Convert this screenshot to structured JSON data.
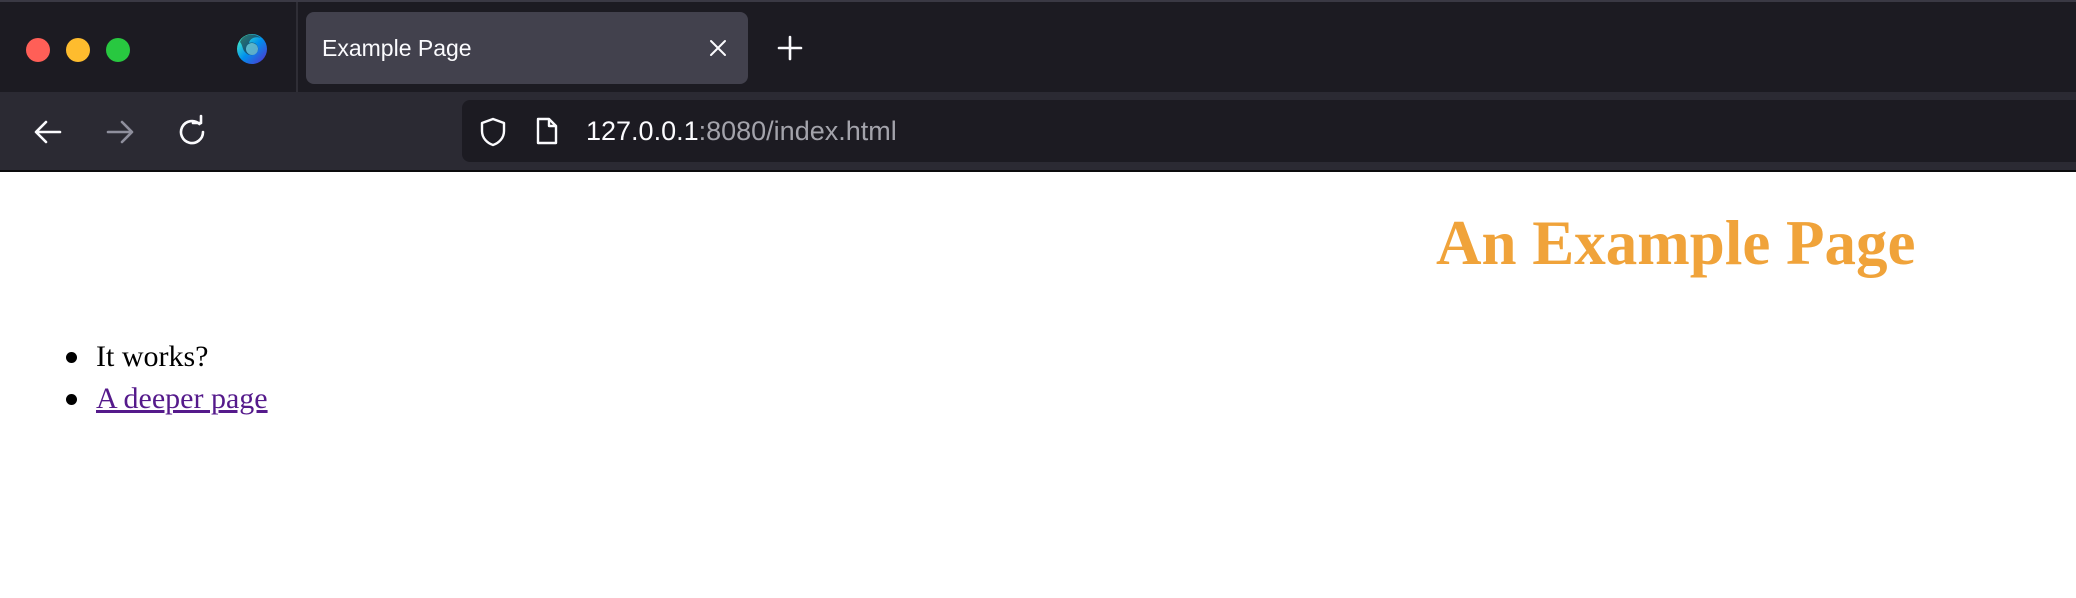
{
  "window": {
    "traffic_lights": [
      "close",
      "minimize",
      "maximize"
    ]
  },
  "tabs": [
    {
      "title": "Example Page",
      "active": true,
      "close_icon": "close-icon"
    }
  ],
  "toolbar": {
    "new_tab_icon": "plus-icon",
    "back_icon": "arrow-left-icon",
    "forward_icon": "arrow-right-icon",
    "reload_icon": "reload-icon"
  },
  "urlbar": {
    "host": "127.0.0.1",
    "rest": ":8080/index.html",
    "security_icon": "shield-icon",
    "page_icon": "page-icon"
  },
  "page": {
    "heading": "An Example Page",
    "heading_color": "#f0a33a",
    "list": [
      {
        "text": "It works?",
        "link": false
      },
      {
        "text": "A deeper page",
        "link": true
      }
    ],
    "link_color": "#551a8b"
  },
  "colors": {
    "tabstrip_bg": "#1c1b22",
    "navbar_bg": "#2b2a33",
    "active_tab_bg": "#42414d",
    "close_light": "#ff5f57",
    "minimize_light": "#febc2e",
    "maximize_light": "#28c840"
  }
}
